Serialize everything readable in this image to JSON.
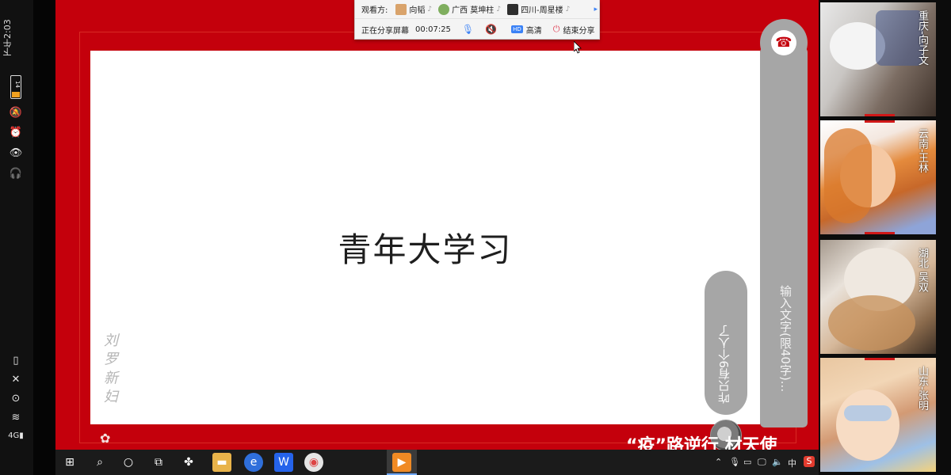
{
  "status_bar": {
    "time": "下午2:03",
    "battery": "14",
    "icons": [
      "battery-icon",
      "mute-icon",
      "alarm-icon",
      "eye-icon",
      "headset-icon"
    ],
    "bottom_icons": [
      "battery-small-icon",
      "nfc-icon",
      "wifi-icon",
      "signal-icon"
    ],
    "network": "4G"
  },
  "share_toolbar": {
    "viewers_label": "观看方:",
    "viewers": [
      {
        "name": "向韬",
        "avatar_color": "#d9a36b"
      },
      {
        "name": "广西  莫坤柱",
        "avatar_color": "#7fae5e"
      },
      {
        "name": "四川-周星楼",
        "avatar_color": "#2e2e2e"
      }
    ],
    "status_text": "正在分享屏幕",
    "elapsed": "00:07:25",
    "quality": "高清",
    "quality_badge": "HD",
    "stop_label": "结束分享"
  },
  "slide": {
    "title": "青年大学习",
    "watermark": "刘 罗 新 妇"
  },
  "chat": {
    "message": "咋只有9个人了",
    "input_hint": "输入文字(限40字)..."
  },
  "marquee": "“疫”路逆行  材天使",
  "participants": [
    {
      "name": "重庆-向子文"
    },
    {
      "name": "云南-王林"
    },
    {
      "name": "湖北  吴双"
    },
    {
      "name": "山东-张明"
    }
  ],
  "taskbar": {
    "apps": [
      "windows-start-icon",
      "search-icon",
      "cortana-icon",
      "task-view-icon",
      "fan-app-icon",
      "file-explorer-icon",
      "browser-icon",
      "wps-icon",
      "chrome-icon",
      "video-app-icon"
    ],
    "tray_lang": "中",
    "tray_app": "S"
  },
  "colors": {
    "frame_red": "#c4000c",
    "pill_gray": "#a6a6a6",
    "accent_blue": "#3b82f6"
  }
}
